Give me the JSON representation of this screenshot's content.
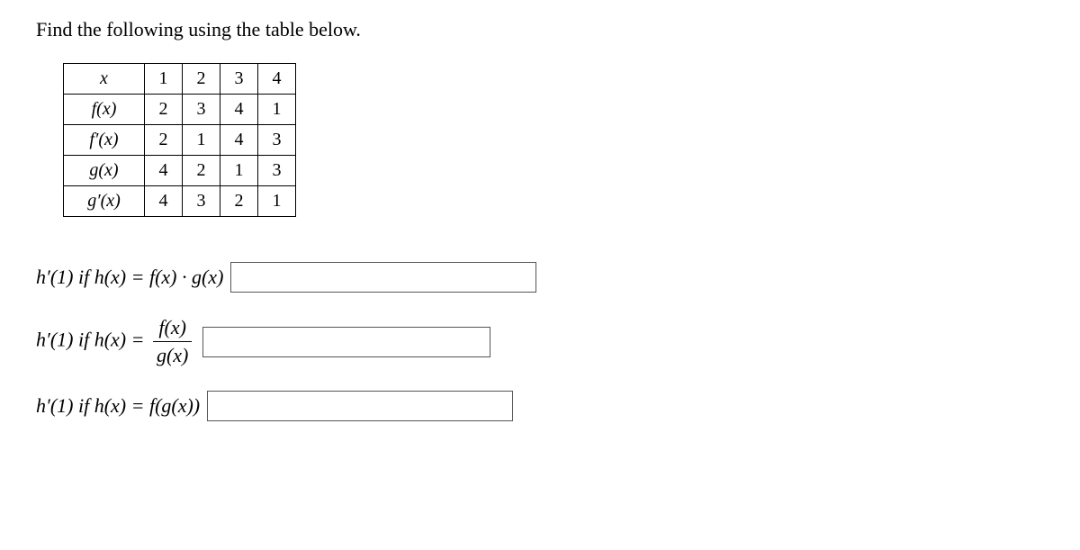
{
  "title": "Find the following using the table below.",
  "table": {
    "rows": [
      {
        "label": "x",
        "c1": "1",
        "c2": "2",
        "c3": "3",
        "c4": "4"
      },
      {
        "label": "f(x)",
        "c1": "2",
        "c2": "3",
        "c3": "4",
        "c4": "1"
      },
      {
        "label": "f′(x)",
        "c1": "2",
        "c2": "1",
        "c3": "4",
        "c4": "3"
      },
      {
        "label": "g(x)",
        "c1": "4",
        "c2": "2",
        "c3": "1",
        "c4": "3"
      },
      {
        "label": "g′(x)",
        "c1": "4",
        "c2": "3",
        "c3": "2",
        "c4": "1"
      }
    ]
  },
  "questions": {
    "q1": "h′(1) if h(x) = f(x) · g(x)",
    "q2_prefix": "h′(1) if h(x) = ",
    "q2_num": "f(x)",
    "q2_den": "g(x)",
    "q3": "h′(1) if h(x) = f(g(x))"
  }
}
